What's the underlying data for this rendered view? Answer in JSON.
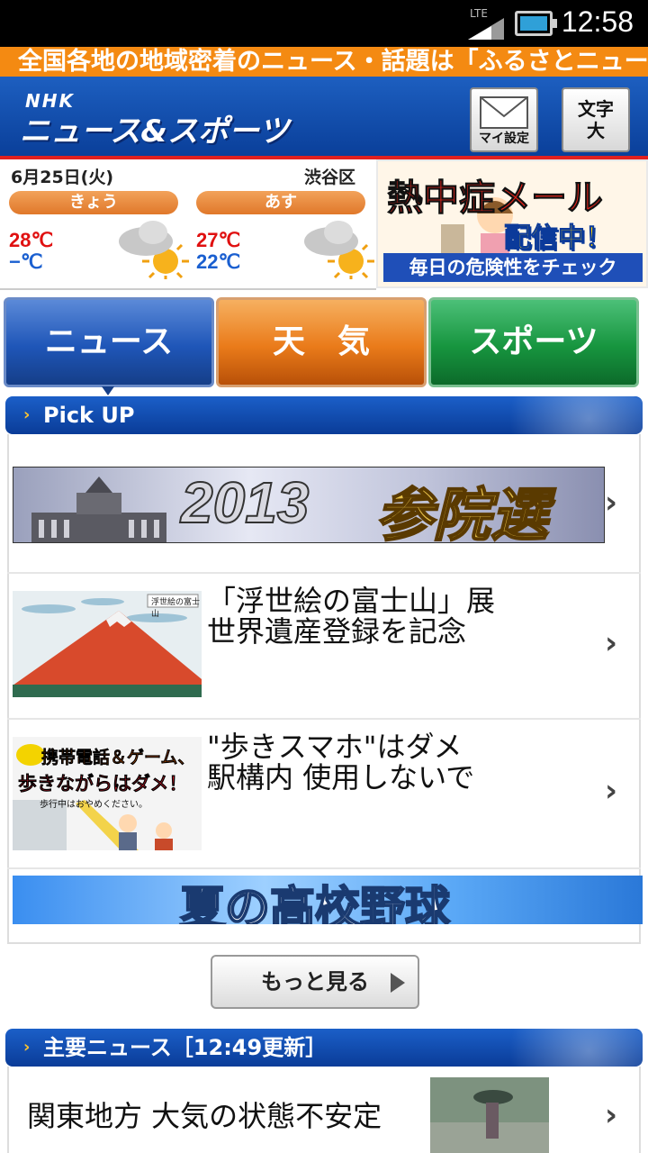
{
  "status_bar": {
    "network": "LTE",
    "time": "12:58"
  },
  "ticker": {
    "text": "全国各地の地域密着のニュース・話題は「ふるさとニュース"
  },
  "header": {
    "logo_small": "NHK",
    "logo_main": "ニュース&スポーツ",
    "settings_label": "マイ設定",
    "textsize_label_1": "文字",
    "textsize_label_2": "大"
  },
  "weather": {
    "date": "6月25日(火)",
    "area": "渋谷区",
    "days": [
      {
        "label": "きょう",
        "high": "28℃",
        "low": "−℃",
        "icon": "cloudy-sunny-icon"
      },
      {
        "label": "あす",
        "high": "27℃",
        "low": "22℃",
        "icon": "cloudy-sunny-icon"
      }
    ]
  },
  "heat_banner": {
    "line1": "熱中症メール",
    "line2": "配信中！",
    "line3": "毎日の危険性をチェック"
  },
  "tabs": [
    {
      "label": "ニュース",
      "selected": true
    },
    {
      "label": "天　気",
      "selected": false
    },
    {
      "label": "スポーツ",
      "selected": false
    }
  ],
  "pickup": {
    "title": "Pick UP",
    "election_banner": {
      "year": "2013",
      "kanji": "参院選"
    },
    "items": [
      {
        "title_line1": "「浮世絵の富士山」展",
        "title_line2": "世界遺産登録を記念",
        "thumb_caption": "浮世絵の富士山"
      },
      {
        "title_line1": "\"歩きスマホ\"はダメ",
        "title_line2": "駅構内 使用しないで",
        "thumb_caption_1": "携帯電話＆ゲーム、",
        "thumb_caption_2": "歩きながらはダメ！",
        "thumb_caption_3": "歩行中はおやめください。"
      }
    ],
    "baseball_banner": "夏の高校野球",
    "more_label": "もっと見る"
  },
  "main_news": {
    "title": "主要ニュース［12:49更新］",
    "items": [
      {
        "title": "関東地方 大気の状態不安定"
      }
    ]
  },
  "colors": {
    "header_blue": "#1d5fc0",
    "ticker_orange": "#f48a12",
    "news_tab": "#1f56b8",
    "weather_tab": "#ea7b1a",
    "sports_tab": "#17953f",
    "temp_high": "#e01010",
    "temp_low": "#1a5fd0"
  }
}
